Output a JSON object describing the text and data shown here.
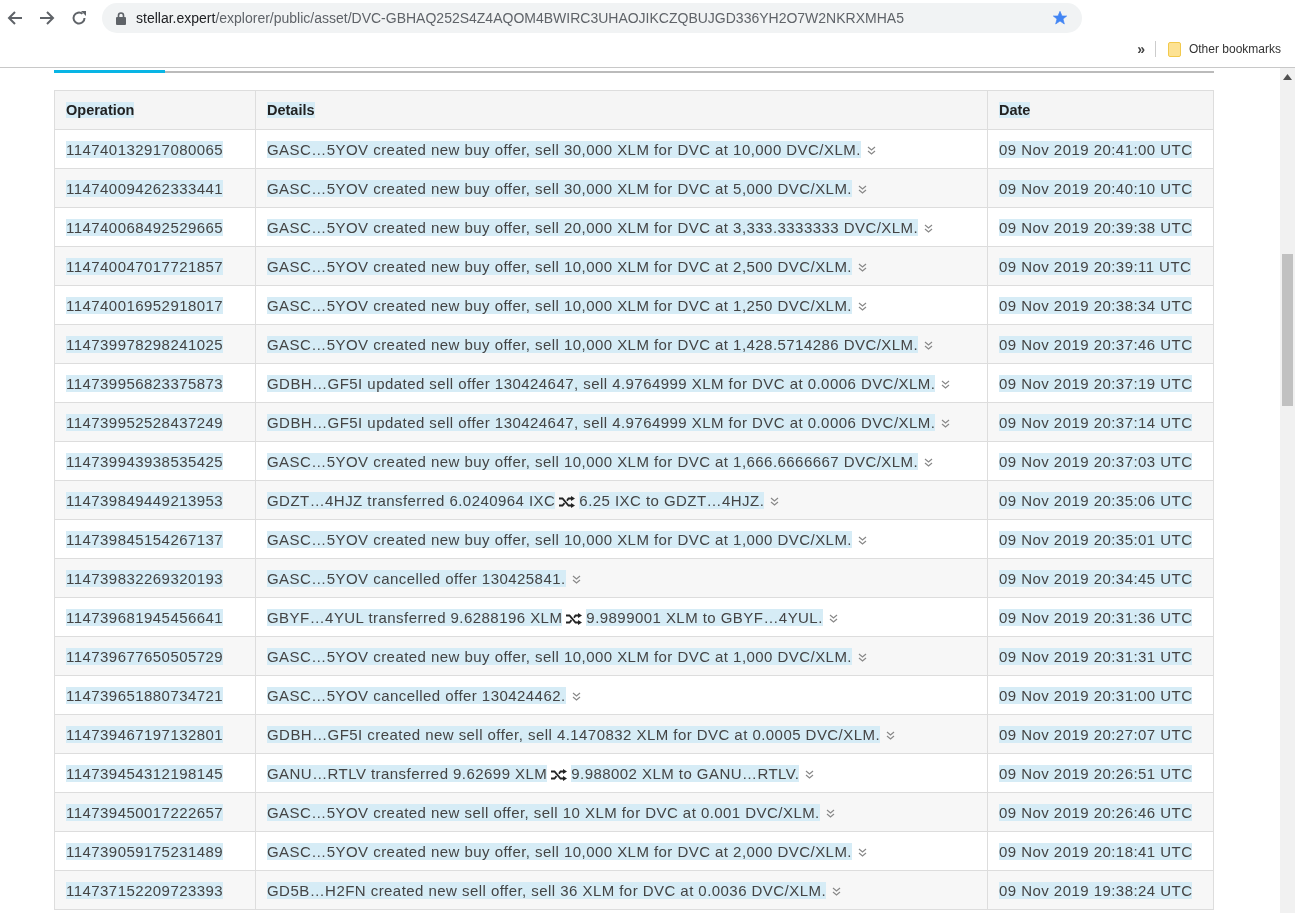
{
  "browser": {
    "url_host": "stellar.expert",
    "url_path": "/explorer/public/asset/DVC-GBHAQ252S4Z4AQOM4BWIRC3UHAOJIKCZQBUJGD336YH2O7W2NKRXMHA5",
    "bookmarked": true,
    "overflow": "»",
    "other_bookmarks": "Other bookmarks"
  },
  "table": {
    "columns": [
      "Operation",
      "Details",
      "Date"
    ],
    "rows": [
      {
        "operation": "114740132917080065",
        "details": {
          "kind": "offer",
          "text": "GASC…5YOV created new buy offer, sell 30,000 XLM for DVC at 10,000 DVC/XLM."
        },
        "date": "09 Nov 2019 20:41:00 UTC"
      },
      {
        "operation": "114740094262333441",
        "details": {
          "kind": "offer",
          "text": "GASC…5YOV created new buy offer, sell 30,000 XLM for DVC at 5,000 DVC/XLM."
        },
        "date": "09 Nov 2019 20:40:10 UTC"
      },
      {
        "operation": "114740068492529665",
        "details": {
          "kind": "offer",
          "text": "GASC…5YOV created new buy offer, sell 20,000 XLM for DVC at 3,333.3333333 DVC/XLM."
        },
        "date": "09 Nov 2019 20:39:38 UTC"
      },
      {
        "operation": "114740047017721857",
        "details": {
          "kind": "offer",
          "text": "GASC…5YOV created new buy offer, sell 10,000 XLM for DVC at 2,500 DVC/XLM."
        },
        "date": "09 Nov 2019 20:39:11 UTC"
      },
      {
        "operation": "114740016952918017",
        "details": {
          "kind": "offer",
          "text": "GASC…5YOV created new buy offer, sell 10,000 XLM for DVC at 1,250 DVC/XLM."
        },
        "date": "09 Nov 2019 20:38:34 UTC"
      },
      {
        "operation": "114739978298241025",
        "details": {
          "kind": "offer",
          "text": "GASC…5YOV created new buy offer, sell 10,000 XLM for DVC at 1,428.5714286 DVC/XLM."
        },
        "date": "09 Nov 2019 20:37:46 UTC"
      },
      {
        "operation": "114739956823375873",
        "details": {
          "kind": "offer",
          "text": "GDBH…GF5I updated sell offer 130424647, sell 4.9764999 XLM for DVC at 0.0006 DVC/XLM."
        },
        "date": "09 Nov 2019 20:37:19 UTC"
      },
      {
        "operation": "114739952528437249",
        "details": {
          "kind": "offer",
          "text": "GDBH…GF5I updated sell offer 130424647, sell 4.9764999 XLM for DVC at 0.0006 DVC/XLM."
        },
        "date": "09 Nov 2019 20:37:14 UTC"
      },
      {
        "operation": "114739943938535425",
        "details": {
          "kind": "offer",
          "text": "GASC…5YOV created new buy offer, sell 10,000 XLM for DVC at 1,666.6666667 DVC/XLM."
        },
        "date": "09 Nov 2019 20:37:03 UTC"
      },
      {
        "operation": "114739849449213953",
        "details": {
          "kind": "transfer",
          "sent": "GDZT…4HJZ transferred 6.0240964 IXC",
          "received": "6.25 IXC to GDZT…4HJZ."
        },
        "date": "09 Nov 2019 20:35:06 UTC"
      },
      {
        "operation": "114739845154267137",
        "details": {
          "kind": "offer",
          "text": "GASC…5YOV created new buy offer, sell 10,000 XLM for DVC at 1,000 DVC/XLM."
        },
        "date": "09 Nov 2019 20:35:01 UTC"
      },
      {
        "operation": "114739832269320193",
        "details": {
          "kind": "offer",
          "text": "GASC…5YOV cancelled offer 130425841."
        },
        "date": "09 Nov 2019 20:34:45 UTC"
      },
      {
        "operation": "114739681945456641",
        "details": {
          "kind": "transfer",
          "sent": "GBYF…4YUL transferred 9.6288196 XLM",
          "received": "9.9899001 XLM to GBYF…4YUL."
        },
        "date": "09 Nov 2019 20:31:36 UTC"
      },
      {
        "operation": "114739677650505729",
        "details": {
          "kind": "offer",
          "text": "GASC…5YOV created new buy offer, sell 10,000 XLM for DVC at 1,000 DVC/XLM."
        },
        "date": "09 Nov 2019 20:31:31 UTC"
      },
      {
        "operation": "114739651880734721",
        "details": {
          "kind": "offer",
          "text": "GASC…5YOV cancelled offer 130424462."
        },
        "date": "09 Nov 2019 20:31:00 UTC"
      },
      {
        "operation": "114739467197132801",
        "details": {
          "kind": "offer",
          "text": "GDBH…GF5I created new sell offer, sell 4.1470832 XLM for DVC at 0.0005 DVC/XLM."
        },
        "date": "09 Nov 2019 20:27:07 UTC"
      },
      {
        "operation": "114739454312198145",
        "details": {
          "kind": "transfer",
          "sent": "GANU…RTLV transferred 9.62699 XLM",
          "received": "9.988002 XLM to GANU…RTLV."
        },
        "date": "09 Nov 2019 20:26:51 UTC"
      },
      {
        "operation": "114739450017222657",
        "details": {
          "kind": "offer",
          "text": "GASC…5YOV created new sell offer, sell 10 XLM for DVC at 0.001 DVC/XLM."
        },
        "date": "09 Nov 2019 20:26:46 UTC"
      },
      {
        "operation": "114739059175231489",
        "details": {
          "kind": "offer",
          "text": "GASC…5YOV created new buy offer, sell 10,000 XLM for DVC at 2,000 DVC/XLM."
        },
        "date": "09 Nov 2019 20:18:41 UTC"
      },
      {
        "operation": "114737152209723393",
        "details": {
          "kind": "offer",
          "text": "GD5B…H2FN created new sell offer, sell 36 XLM for DVC at 0.0036 DVC/XLM."
        },
        "date": "09 Nov 2019 19:38:24 UTC"
      }
    ]
  }
}
